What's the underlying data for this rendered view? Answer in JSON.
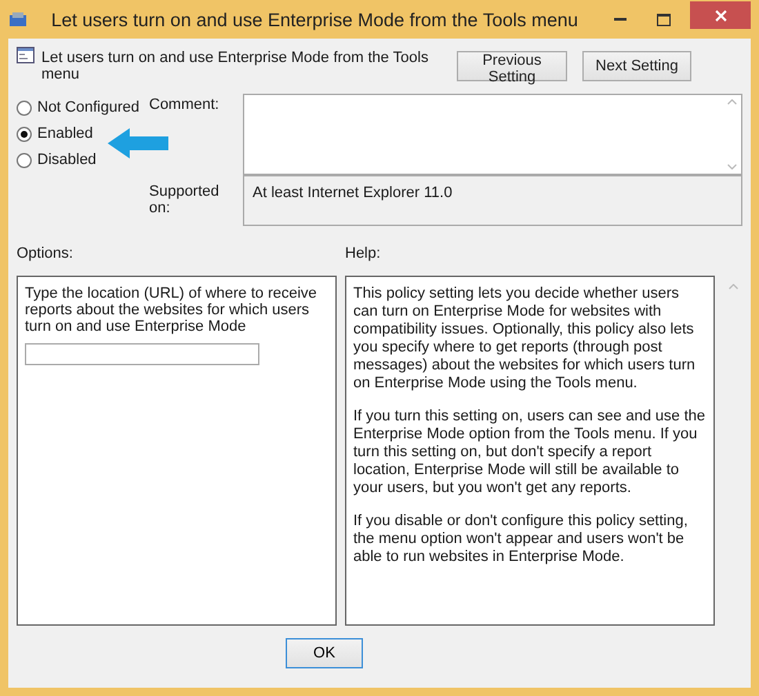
{
  "window": {
    "title": "Let users turn on and use Enterprise Mode from the Tools menu"
  },
  "header": {
    "setting_name": "Let users turn on and use Enterprise Mode from the Tools menu",
    "buttons": [
      {
        "label": "Previous Setting"
      },
      {
        "label": "Next Setting"
      }
    ]
  },
  "state_options": [
    {
      "label": "Not Configured",
      "selected": false
    },
    {
      "label": "Enabled",
      "selected": true
    },
    {
      "label": "Disabled",
      "selected": false
    }
  ],
  "comment": {
    "label": "Comment:"
  },
  "supported_on": {
    "label": "Supported on:",
    "value": "At least Internet Explorer 11.0"
  },
  "options": {
    "label": "Options:",
    "description": "Type the location (URL) of where to receive reports about the websites for which users turn on and use Enterprise Mode"
  },
  "help": {
    "label": "Help:",
    "paragraphs": [
      "This policy setting lets you decide whether users can turn on Enterprise Mode for websites with compatibility issues. Optionally, this policy also lets you specify where to get reports (through post messages) about the websites for which users turn on Enterprise Mode using the Tools menu.",
      "If you turn this setting on, users can see and use the Enterprise Mode option from the Tools menu. If you turn this setting on, but don't specify a report location, Enterprise Mode will still be available to your users, but you won't get any reports.",
      "If you disable or don't configure this policy setting, the menu option won't appear and users won't be able to run websites in Enterprise Mode."
    ]
  },
  "footer_buttons": [
    {
      "label": "OK"
    }
  ]
}
